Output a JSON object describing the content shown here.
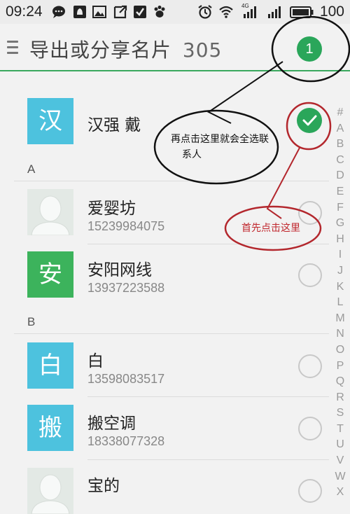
{
  "status_bar": {
    "time": "09:24",
    "battery_text": "100",
    "network_label": "4G"
  },
  "action_bar": {
    "title": "导出或分享名片",
    "count": "305",
    "selected_badge": "1"
  },
  "select_all": {
    "avatar_char": "汉",
    "name": "汉强 戴"
  },
  "sections": [
    {
      "header": "A"
    },
    {
      "header": "B"
    }
  ],
  "contacts": [
    {
      "name": "爱婴坊",
      "phone": "15239984075",
      "avatar": "photo",
      "avatar_char": ""
    },
    {
      "name": "安阳网线",
      "phone": "13937223588",
      "avatar": "green",
      "avatar_char": "安"
    },
    {
      "name": "白",
      "phone": "13598083517",
      "avatar": "blue",
      "avatar_char": "白"
    },
    {
      "name": "搬空调",
      "phone": "18338077328",
      "avatar": "blue",
      "avatar_char": "搬"
    },
    {
      "name": "宝的",
      "phone": "",
      "avatar": "photo",
      "avatar_char": ""
    }
  ],
  "alphabet_index": [
    "#",
    "A",
    "B",
    "C",
    "D",
    "E",
    "F",
    "G",
    "H",
    "I",
    "J",
    "K",
    "L",
    "M",
    "N",
    "O",
    "P",
    "Q",
    "R",
    "S",
    "T",
    "U",
    "V",
    "W",
    "X"
  ],
  "annotations": {
    "black_callout": [
      "再点击这里就会全选联",
      "系人"
    ],
    "red_callout": "首先点击这里"
  },
  "colors": {
    "accent_green": "#2aa65a",
    "avatar_blue": "#4dc2de",
    "avatar_green": "#3cb35c",
    "annotation_red": "#c0272d"
  }
}
